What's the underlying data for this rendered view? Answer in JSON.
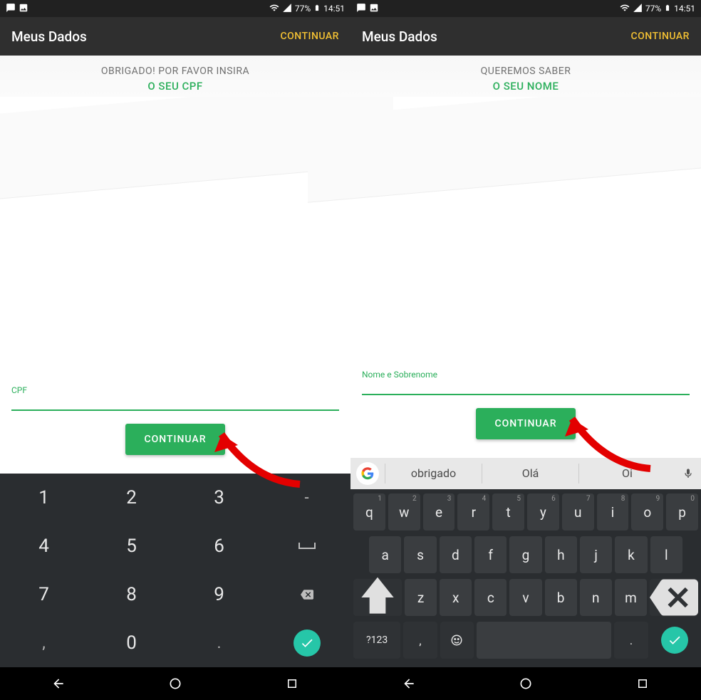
{
  "status": {
    "battery": "77%",
    "time": "14:51"
  },
  "appbar": {
    "title": "Meus Dados",
    "action": "CONTINUAR"
  },
  "left": {
    "prompt1": "OBRIGADO! POR FAVOR INSIRA",
    "prompt2": "O SEU CPF",
    "input_label": "CPF",
    "button": "CONTINUAR",
    "numeric_keys": {
      "r1": [
        "1",
        "2",
        "3",
        "-"
      ],
      "r2": [
        "4",
        "5",
        "6",
        "⌴"
      ],
      "r3": [
        "7",
        "8",
        "9",
        "⌫"
      ],
      "r4": [
        ",",
        "0",
        ".",
        "✓"
      ]
    }
  },
  "right": {
    "prompt1": "QUEREMOS SABER",
    "prompt2": "O SEU NOME",
    "input_label": "Nome e Sobrenome",
    "button": "CONTINUAR",
    "suggestions": [
      "obrigado",
      "Olá",
      "Oi"
    ],
    "row1": [
      {
        "k": "q",
        "s": "1"
      },
      {
        "k": "w",
        "s": "2"
      },
      {
        "k": "e",
        "s": "3"
      },
      {
        "k": "r",
        "s": "4"
      },
      {
        "k": "t",
        "s": "5"
      },
      {
        "k": "y",
        "s": "6"
      },
      {
        "k": "u",
        "s": "7"
      },
      {
        "k": "i",
        "s": "8"
      },
      {
        "k": "o",
        "s": "9"
      },
      {
        "k": "p",
        "s": "0"
      }
    ],
    "row2": [
      "a",
      "s",
      "d",
      "f",
      "g",
      "h",
      "j",
      "k",
      "l"
    ],
    "row3": [
      "z",
      "x",
      "c",
      "v",
      "b",
      "n",
      "m"
    ],
    "symkey": "?123",
    "period": "."
  }
}
